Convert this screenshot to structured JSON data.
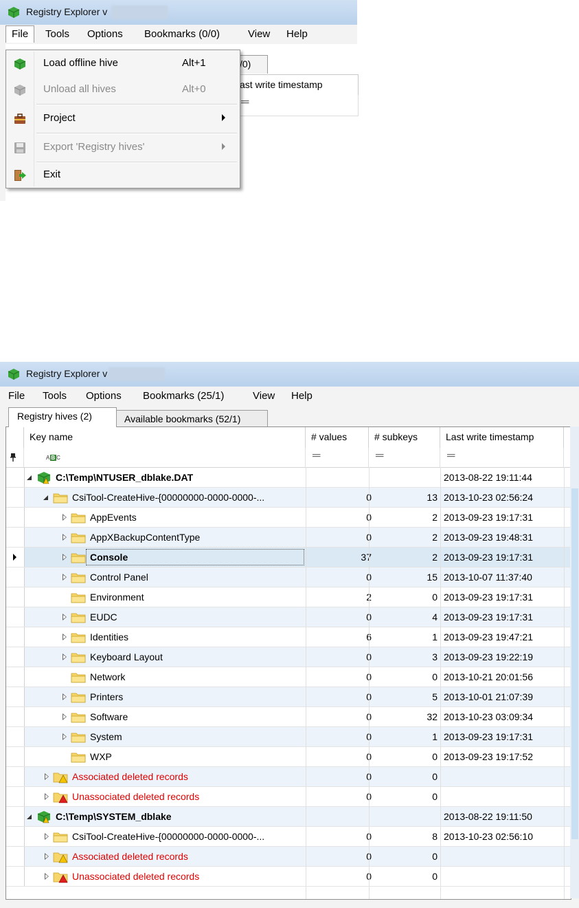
{
  "top": {
    "title": "Registry Explorer v",
    "menu": [
      "File",
      "Tools",
      "Options",
      "Bookmarks (0/0)",
      "View",
      "Help"
    ],
    "tab_fragment": "/0)",
    "header_fragment": "ast write timestamp",
    "filter_symbol": "═",
    "file_menu": [
      {
        "label": "Load offline hive",
        "shortcut": "Alt+1",
        "icon": "hive-green-icon",
        "disabled": false
      },
      {
        "label": "Unload all hives",
        "shortcut": "Alt+0",
        "icon": "hive-gray-icon",
        "disabled": true
      },
      {
        "label": "Project",
        "shortcut": "",
        "icon": "briefcase-icon",
        "disabled": false,
        "submenu": true
      },
      {
        "label": "Export 'Registry hives'",
        "shortcut": "",
        "icon": "floppy-disk-icon",
        "disabled": true,
        "submenu": true
      },
      {
        "label": "Exit",
        "shortcut": "",
        "icon": "exit-door-icon",
        "disabled": false
      }
    ]
  },
  "bottom": {
    "title": "Registry Explorer v",
    "menu": [
      "File",
      "Tools",
      "Options",
      "Bookmarks (25/1)",
      "View",
      "Help"
    ],
    "tabs": [
      "Registry hives (2)",
      "Available bookmarks (52/1)"
    ],
    "columns": [
      "Key name",
      "# values",
      "# subkeys",
      "Last write timestamp"
    ],
    "filter_symbol": "═",
    "abc_label": "ABC",
    "rows": [
      {
        "name": "C:\\Temp\\NTUSER_dblake.DAT",
        "values": "",
        "subkeys": "",
        "timestamp": "2013-08-22 19:11:44",
        "level": 0,
        "type": "hive",
        "expander": "open",
        "bold": true
      },
      {
        "name": "CsiTool-CreateHive-{00000000-0000-0000-...",
        "values": "0",
        "subkeys": "13",
        "timestamp": "2013-10-23 02:56:24",
        "level": 1,
        "type": "folder",
        "expander": "open"
      },
      {
        "name": "AppEvents",
        "values": "0",
        "subkeys": "2",
        "timestamp": "2013-09-23 19:17:31",
        "level": 2,
        "type": "folder",
        "expander": "closed"
      },
      {
        "name": "AppXBackupContentType",
        "values": "0",
        "subkeys": "2",
        "timestamp": "2013-09-23 19:48:31",
        "level": 2,
        "type": "folder",
        "expander": "closed"
      },
      {
        "name": "Console",
        "values": "37",
        "subkeys": "2",
        "timestamp": "2013-09-23 19:17:31",
        "level": 2,
        "type": "folder",
        "expander": "closed",
        "bold": true,
        "selected": true
      },
      {
        "name": "Control Panel",
        "values": "0",
        "subkeys": "15",
        "timestamp": "2013-10-07 11:37:40",
        "level": 2,
        "type": "folder",
        "expander": "closed"
      },
      {
        "name": "Environment",
        "values": "2",
        "subkeys": "0",
        "timestamp": "2013-09-23 19:17:31",
        "level": 2,
        "type": "folder",
        "expander": "none"
      },
      {
        "name": "EUDC",
        "values": "0",
        "subkeys": "4",
        "timestamp": "2013-09-23 19:17:31",
        "level": 2,
        "type": "folder",
        "expander": "closed"
      },
      {
        "name": "Identities",
        "values": "6",
        "subkeys": "1",
        "timestamp": "2013-09-23 19:47:21",
        "level": 2,
        "type": "folder",
        "expander": "closed"
      },
      {
        "name": "Keyboard Layout",
        "values": "0",
        "subkeys": "3",
        "timestamp": "2013-09-23 19:22:19",
        "level": 2,
        "type": "folder",
        "expander": "closed"
      },
      {
        "name": "Network",
        "values": "0",
        "subkeys": "0",
        "timestamp": "2013-10-21 20:01:56",
        "level": 2,
        "type": "folder",
        "expander": "none"
      },
      {
        "name": "Printers",
        "values": "0",
        "subkeys": "5",
        "timestamp": "2013-10-01 21:07:39",
        "level": 2,
        "type": "folder",
        "expander": "closed"
      },
      {
        "name": "Software",
        "values": "0",
        "subkeys": "32",
        "timestamp": "2013-10-23 03:09:34",
        "level": 2,
        "type": "folder",
        "expander": "closed"
      },
      {
        "name": "System",
        "values": "0",
        "subkeys": "1",
        "timestamp": "2013-09-23 19:17:31",
        "level": 2,
        "type": "folder",
        "expander": "closed"
      },
      {
        "name": "WXP",
        "values": "0",
        "subkeys": "0",
        "timestamp": "2013-09-23 19:17:52",
        "level": 2,
        "type": "folder",
        "expander": "none"
      },
      {
        "name": "Associated deleted records",
        "values": "0",
        "subkeys": "0",
        "timestamp": "",
        "level": 1,
        "type": "warn-folder",
        "expander": "closed",
        "red": true
      },
      {
        "name": "Unassociated deleted records",
        "values": "0",
        "subkeys": "0",
        "timestamp": "",
        "level": 1,
        "type": "error-folder",
        "expander": "closed",
        "red": true
      },
      {
        "name": "C:\\Temp\\SYSTEM_dblake",
        "values": "",
        "subkeys": "",
        "timestamp": "2013-08-22 19:11:50",
        "level": 0,
        "type": "hive",
        "expander": "open",
        "bold": true
      },
      {
        "name": "CsiTool-CreateHive-{00000000-0000-0000-...",
        "values": "0",
        "subkeys": "8",
        "timestamp": "2013-10-23 02:56:10",
        "level": 1,
        "type": "folder",
        "expander": "closed"
      },
      {
        "name": "Associated deleted records",
        "values": "0",
        "subkeys": "0",
        "timestamp": "",
        "level": 1,
        "type": "warn-folder",
        "expander": "closed",
        "red": true
      },
      {
        "name": "Unassociated deleted records",
        "values": "0",
        "subkeys": "0",
        "timestamp": "",
        "level": 1,
        "type": "error-folder",
        "expander": "closed",
        "red": true
      }
    ]
  },
  "colors": {
    "titlebar": "#c4d8ef",
    "folder": "#f6d56a",
    "deleted_text": "#e00000",
    "hive_green": "#3aa63a",
    "row_alt": "#edf3fa"
  }
}
